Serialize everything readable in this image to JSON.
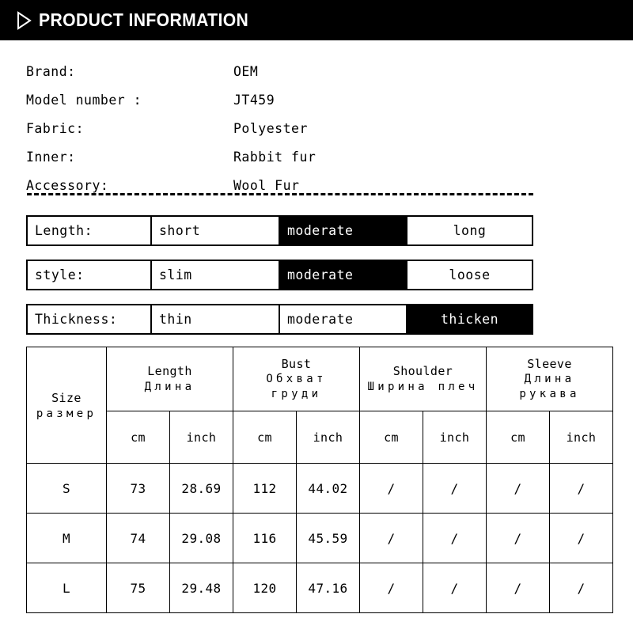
{
  "header": {
    "title": "PRODUCT INFORMATION",
    "icon": "play-triangle-outline-icon"
  },
  "specs": [
    {
      "label": "Brand:",
      "value": "OEM"
    },
    {
      "label": "Model number :",
      "value": "JT459"
    },
    {
      "label": "Fabric:",
      "value": "Polyester"
    },
    {
      "label": "Inner:",
      "value": "Rabbit fur"
    },
    {
      "label": "Accessory:",
      "value": "Wool Fur"
    }
  ],
  "options": [
    {
      "label": "Length:",
      "choices": [
        "short",
        "moderate",
        "long"
      ],
      "selected": "moderate"
    },
    {
      "label": "style:",
      "choices": [
        "slim",
        "moderate",
        "loose"
      ],
      "selected": "moderate"
    },
    {
      "label": "Thickness:",
      "choices": [
        "thin",
        "moderate",
        "thicken"
      ],
      "selected": "thicken"
    }
  ],
  "size_table": {
    "groups": [
      {
        "en": "Size",
        "ru": "размер"
      },
      {
        "en": "Length",
        "ru": "Длина"
      },
      {
        "en": "Bust",
        "ru": "Обхват груди"
      },
      {
        "en": "Shoulder",
        "ru": "Ширина плеч"
      },
      {
        "en": "Sleeve",
        "ru": "Длина рукава"
      }
    ],
    "units": [
      "cm",
      "inch",
      "cm",
      "inch",
      "cm",
      "inch",
      "cm",
      "inch"
    ],
    "rows": [
      {
        "size": "S",
        "length_cm": "73",
        "length_inch": "28.69",
        "bust_cm": "112",
        "bust_inch": "44.02",
        "shoulder_cm": "/",
        "shoulder_inch": "/",
        "sleeve_cm": "/",
        "sleeve_inch": "/"
      },
      {
        "size": "M",
        "length_cm": "74",
        "length_inch": "29.08",
        "bust_cm": "116",
        "bust_inch": "45.59",
        "shoulder_cm": "/",
        "shoulder_inch": "/",
        "sleeve_cm": "/",
        "sleeve_inch": "/"
      },
      {
        "size": "L",
        "length_cm": "75",
        "length_inch": "29.48",
        "bust_cm": "120",
        "bust_inch": "47.16",
        "shoulder_cm": "/",
        "shoulder_inch": "/",
        "sleeve_cm": "/",
        "sleeve_inch": "/"
      }
    ]
  },
  "colors": {
    "bar": "#000000",
    "bar_text": "#ffffff",
    "selected_bg": "#000000",
    "selected_text": "#ffffff",
    "border": "#000000",
    "page_bg": "#ffffff"
  }
}
